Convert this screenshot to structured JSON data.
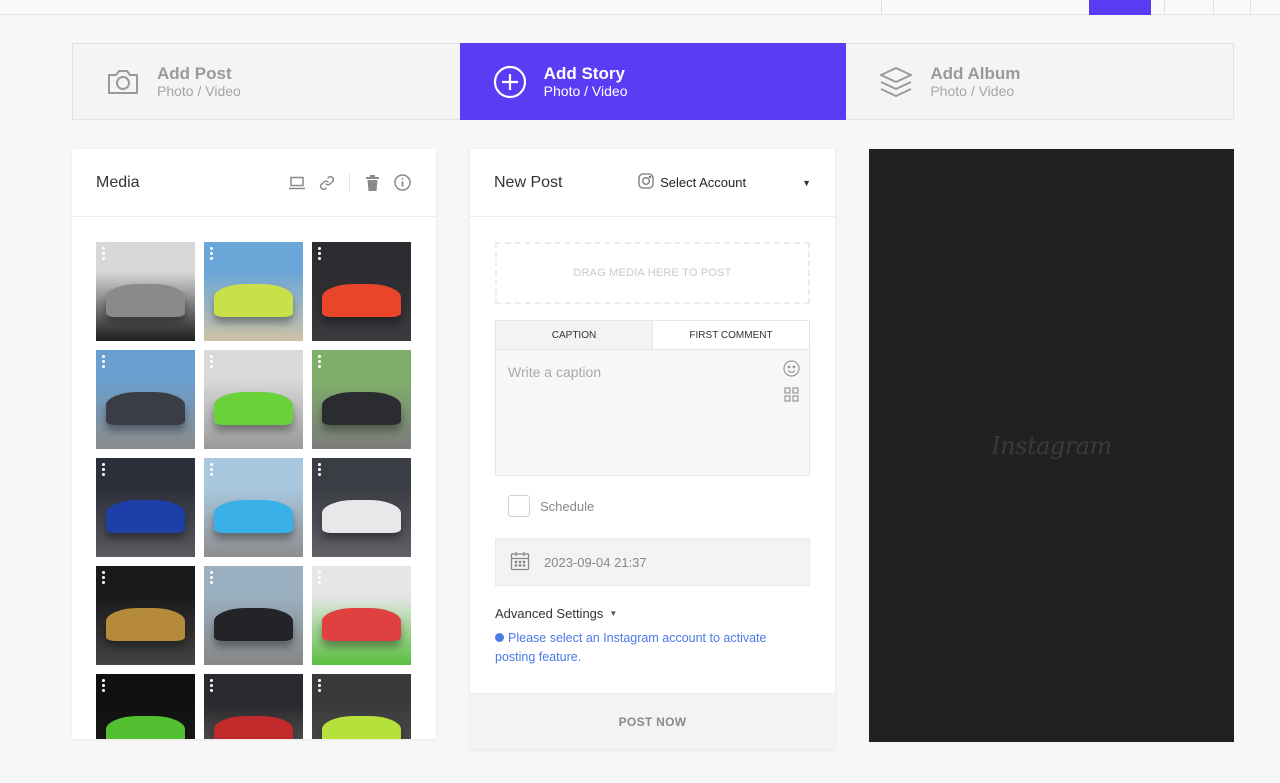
{
  "type_tabs": [
    {
      "title": "Add Post",
      "sub": "Photo / Video",
      "icon": "camera-icon"
    },
    {
      "title": "Add Story",
      "sub": "Photo / Video",
      "icon": "plus-circle-icon"
    },
    {
      "title": "Add Album",
      "sub": "Photo / Video",
      "icon": "layers-icon"
    }
  ],
  "media": {
    "title": "Media",
    "tools": [
      "laptop-icon",
      "link-icon",
      "trash-icon",
      "info-icon"
    ],
    "thumbnails": [
      {
        "desc": "black Rolls-Royce",
        "colors": [
          "#d8d8d8",
          "#8a8a8a",
          "#1c1c1c"
        ]
      },
      {
        "desc": "lime Aston Martin",
        "colors": [
          "#6aa6d8",
          "#c8e04a",
          "#cfc2a6"
        ]
      },
      {
        "desc": "orange Lamborghini",
        "colors": [
          "#2b2b30",
          "#e8452a",
          "#3a3a3f"
        ]
      },
      {
        "desc": "grey Porsche GT3",
        "colors": [
          "#6aa0d0",
          "#3a3d44",
          "#8b8b8b"
        ]
      },
      {
        "desc": "green Porsche showroom",
        "colors": [
          "#d9d9d9",
          "#6ad23a",
          "#9a9a9a"
        ]
      },
      {
        "desc": "black Porsche outdoor",
        "colors": [
          "#7fae6a",
          "#2a2c30",
          "#7b7b7b"
        ]
      },
      {
        "desc": "blue SUV garage",
        "colors": [
          "#2c2f3a",
          "#1e3ea8",
          "#5a5a60"
        ]
      },
      {
        "desc": "blue McLaren",
        "colors": [
          "#a8c8e0",
          "#3ab0e8",
          "#8e8e8e"
        ]
      },
      {
        "desc": "white Bugatti",
        "colors": [
          "#3b3d44",
          "#e8e8ea",
          "#606066"
        ]
      },
      {
        "desc": "gold Lamborghini",
        "colors": [
          "#1a1a1c",
          "#b58a3a",
          "#444"
        ]
      },
      {
        "desc": "black Porsche GT3 RS",
        "colors": [
          "#9ab0c0",
          "#222428",
          "#868686"
        ]
      },
      {
        "desc": "colorful supercar garage",
        "colors": [
          "#e6e6e6",
          "#e04040",
          "#5ac040"
        ]
      },
      {
        "desc": "green Lamborghini",
        "colors": [
          "#101010",
          "#52c030",
          "#202020"
        ]
      },
      {
        "desc": "red car garage",
        "colors": [
          "#2a2a2e",
          "#c02a2a",
          "#6a6a6a"
        ]
      },
      {
        "desc": "lime Lamborghini",
        "colors": [
          "#3a3a3a",
          "#b6e03a",
          "#555"
        ]
      }
    ]
  },
  "post": {
    "title": "New Post",
    "account_label": "Select Account",
    "dropzone": "DRAG MEDIA HERE TO POST",
    "tabs": [
      "CAPTION",
      "FIRST COMMENT"
    ],
    "caption_placeholder": "Write a caption",
    "schedule_label": "Schedule",
    "date_value": "2023-09-04 21:37",
    "advanced_label": "Advanced Settings",
    "notice": "Please select an Instagram account to activate posting feature.",
    "post_now": "POST NOW"
  },
  "preview": {
    "logo": "Instagram"
  },
  "colors": {
    "accent": "#5b3cf5",
    "notice": "#4a79e8",
    "preview_bg": "#212121"
  }
}
